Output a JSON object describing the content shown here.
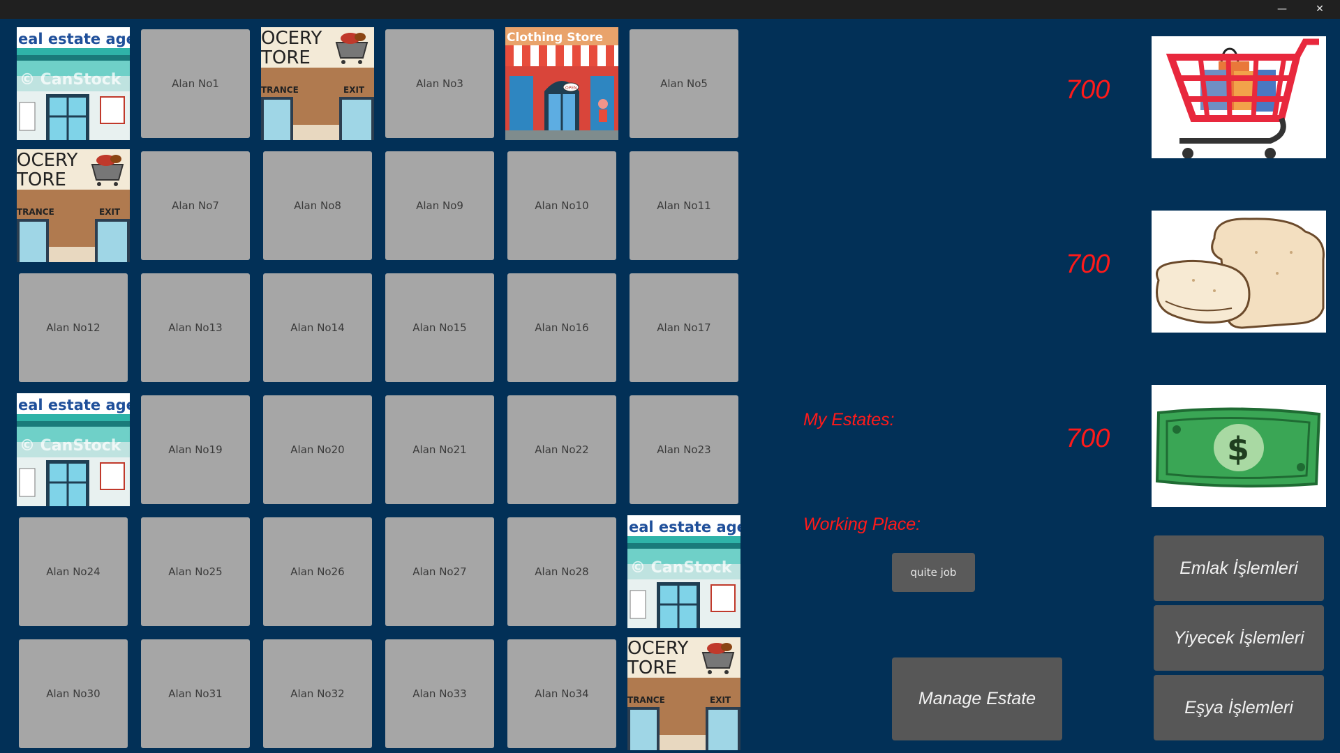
{
  "window": {
    "minimize_glyph": "—",
    "close_glyph": "✕"
  },
  "grid": {
    "tiles": [
      {
        "label": "Alan No1"
      },
      {
        "label": "Alan No3"
      },
      {
        "label": "Alan No5"
      },
      {
        "label": "Alan No7"
      },
      {
        "label": "Alan No8"
      },
      {
        "label": "Alan No9"
      },
      {
        "label": "Alan No10"
      },
      {
        "label": "Alan No11"
      },
      {
        "label": "Alan No12"
      },
      {
        "label": "Alan No13"
      },
      {
        "label": "Alan No14"
      },
      {
        "label": "Alan No15"
      },
      {
        "label": "Alan No16"
      },
      {
        "label": "Alan No17"
      },
      {
        "label": "Alan No19"
      },
      {
        "label": "Alan No20"
      },
      {
        "label": "Alan No21"
      },
      {
        "label": "Alan No22"
      },
      {
        "label": "Alan No23"
      },
      {
        "label": "Alan No24"
      },
      {
        "label": "Alan No25"
      },
      {
        "label": "Alan No26"
      },
      {
        "label": "Alan No27"
      },
      {
        "label": "Alan No28"
      },
      {
        "label": "Alan No30"
      },
      {
        "label": "Alan No31"
      },
      {
        "label": "Alan No32"
      },
      {
        "label": "Alan No33"
      },
      {
        "label": "Alan No34"
      }
    ],
    "image_tiles": [
      {
        "kind": "real-estate-agency",
        "text": "eal estate agen",
        "watermark": "© CanStock"
      },
      {
        "kind": "grocery-store",
        "text_top": "OCERY",
        "text_mid": "TORE",
        "text_left": "TRANCE",
        "text_right": "EXIT"
      },
      {
        "kind": "clothing-store",
        "text": "Clothing Store",
        "sign": "OPEN"
      },
      {
        "kind": "grocery-store",
        "text_top": "OCERY",
        "text_mid": "TORE",
        "text_left": "TRANCE",
        "text_right": "EXIT"
      },
      {
        "kind": "real-estate-agency",
        "text": "eal estate agen",
        "watermark": "© CanStock"
      },
      {
        "kind": "real-estate-agency",
        "text": "eal estate agen",
        "watermark": "© CanStock"
      },
      {
        "kind": "grocery-store",
        "text_top": "OCERY",
        "text_mid": "TORE",
        "text_left": "TRANCE",
        "text_right": "EXIT"
      }
    ]
  },
  "stats": {
    "shopping_value": "700",
    "food_value": "700",
    "money_value": "700",
    "shopping_icon": "shopping-cart-icon",
    "food_icon": "bread-icon",
    "money_icon": "dollar-bill-icon"
  },
  "info": {
    "my_estates_label": "My Estates:",
    "working_place_label": "Working Place:",
    "quit_job_button": "quite job",
    "manage_estate_button": "Manage Estate"
  },
  "actions": {
    "emlak": "Emlak İşlemleri",
    "yiyecek": "Yiyecek İşlemleri",
    "esya": "Eşya İşlemleri"
  },
  "colors": {
    "background": "#023057",
    "titlebar": "#202020",
    "tile": "#a6a6a6",
    "accent_red": "#ff1a1a",
    "button": "#575757"
  }
}
